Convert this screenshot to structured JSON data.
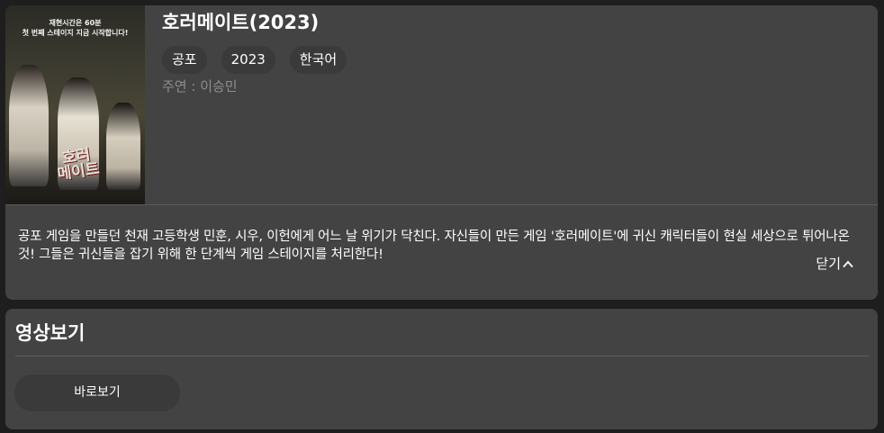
{
  "poster": {
    "tagline_line1": "재현시간은 60분",
    "tagline_line2": "첫 번째 스테이지 지금 시작합니다!",
    "title_line1": "호러",
    "title_line2": "메이트"
  },
  "movie": {
    "title": "호러메이트(2023)",
    "tags": [
      "공포",
      "2023",
      "한국어"
    ],
    "cast": "주연 : 이승민",
    "synopsis": "공포 게임을 만들던 천재 고등학생 민훈, 시우, 이헌에게 어느 날 위기가 닥친다. 자신들이 만든 게임 '호러메이트'에 귀신 캐릭터들이 현실 세상으로 튀어나온 것! 그들은 귀신들을 잡기 위해 한 단계씩 게임 스테이지를 처리한다!",
    "close_label": "닫기",
    "close_icon": "chevron-up-icon"
  },
  "watch": {
    "title": "영상보기",
    "play_label": "바로보기"
  }
}
